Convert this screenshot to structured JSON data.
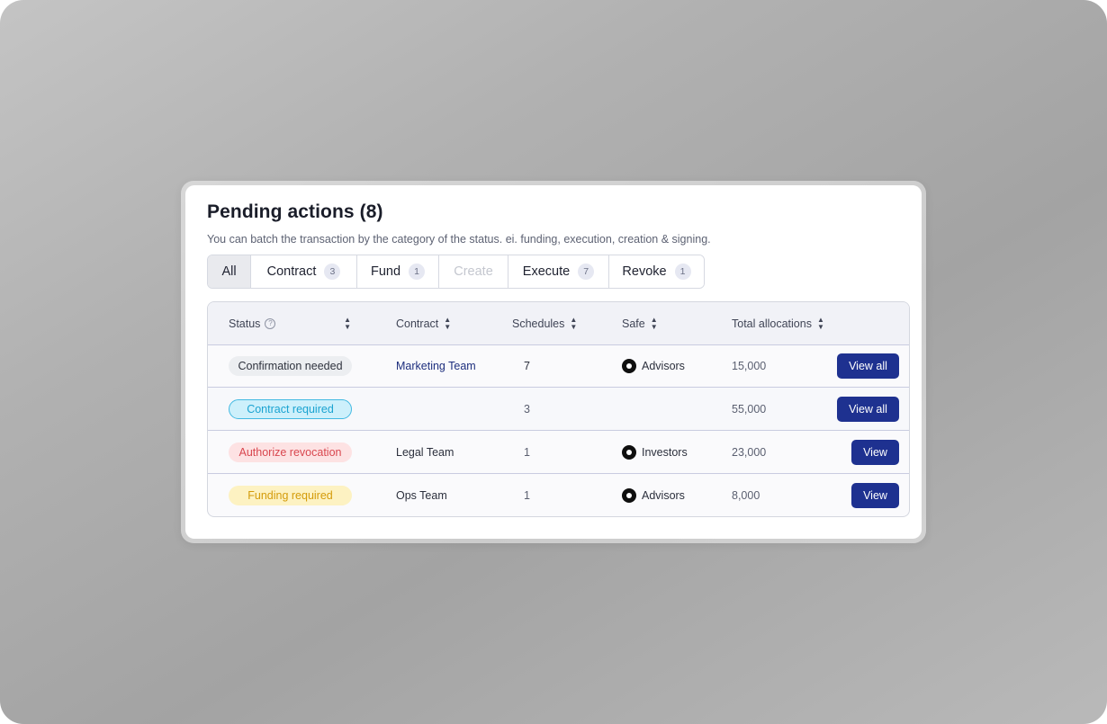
{
  "title": "Pending actions (8)",
  "subtitle": "You can batch the transaction by the category of the status. ei. funding, execution, creation & signing.",
  "tabs": [
    {
      "label": "All",
      "count": null,
      "state": "active"
    },
    {
      "label": "Contract",
      "count": "3",
      "state": "normal"
    },
    {
      "label": "Fund",
      "count": "1",
      "state": "normal"
    },
    {
      "label": "Create",
      "count": null,
      "state": "disabled"
    },
    {
      "label": "Execute",
      "count": "7",
      "state": "normal"
    },
    {
      "label": "Revoke",
      "count": "1",
      "state": "normal"
    }
  ],
  "table": {
    "headers": {
      "status": "Status",
      "contract": "Contract",
      "schedules": "Schedules",
      "safe": "Safe",
      "total": "Total allocations"
    },
    "rows": [
      {
        "status": "Confirmation needed",
        "status_color": "gray",
        "contract": "Marketing Team",
        "schedules": "7",
        "safe": "Advisors",
        "total": "15,000",
        "action": "View all"
      },
      {
        "status": "Contract required",
        "status_color": "cyan",
        "contract": "",
        "schedules": "3",
        "safe": "",
        "total": "55,000",
        "action": "View all"
      },
      {
        "status": "Authorize revocation",
        "status_color": "red",
        "contract": "Legal Team",
        "schedules": "1",
        "safe": "Investors",
        "total": "23,000",
        "action": "View"
      },
      {
        "status": "Funding required",
        "status_color": "yellow",
        "contract": "Ops Team",
        "schedules": "1",
        "safe": "Advisors",
        "total": "8,000",
        "action": "View"
      }
    ]
  },
  "colors": {
    "primary_button": "#1e3190",
    "link": "#1e2f7e"
  }
}
